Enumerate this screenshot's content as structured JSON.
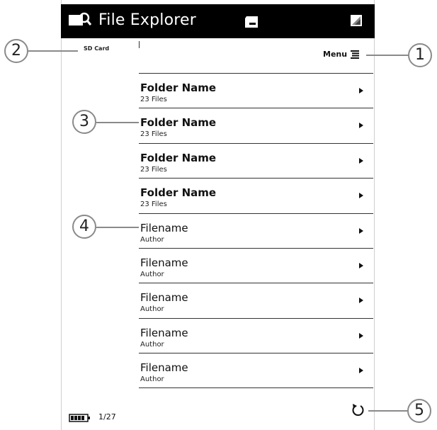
{
  "app": {
    "title": "File Explorer",
    "storage_label": "SD Card"
  },
  "menu": {
    "label": "Menu"
  },
  "list": [
    {
      "title": "Folder Name",
      "subtitle": "23 Files",
      "type": "folder"
    },
    {
      "title": "Folder Name",
      "subtitle": "23 Files",
      "type": "folder"
    },
    {
      "title": "Folder Name",
      "subtitle": "23 Files",
      "type": "folder"
    },
    {
      "title": "Folder Name",
      "subtitle": "23 Files",
      "type": "folder"
    },
    {
      "title": "Filename",
      "subtitle": "Author",
      "type": "file"
    },
    {
      "title": "Filename",
      "subtitle": "Author",
      "type": "file"
    },
    {
      "title": "Filename",
      "subtitle": "Author",
      "type": "file"
    },
    {
      "title": "Filename",
      "subtitle": "Author",
      "type": "file"
    },
    {
      "title": "Filename",
      "subtitle": "Author",
      "type": "file"
    }
  ],
  "status": {
    "page": "1/27"
  },
  "callouts": [
    "1",
    "2",
    "3",
    "4",
    "5"
  ],
  "icons": {
    "app": "file-explorer-icon",
    "sd": "sd-card-icon",
    "image": "image-icon",
    "menu": "menu-lines-icon",
    "arrow": "chevron-right-icon",
    "battery": "battery-icon",
    "refresh": "refresh-icon"
  },
  "colors": {
    "titlebar": "#000000",
    "callout_border": "#8a8a8a"
  }
}
